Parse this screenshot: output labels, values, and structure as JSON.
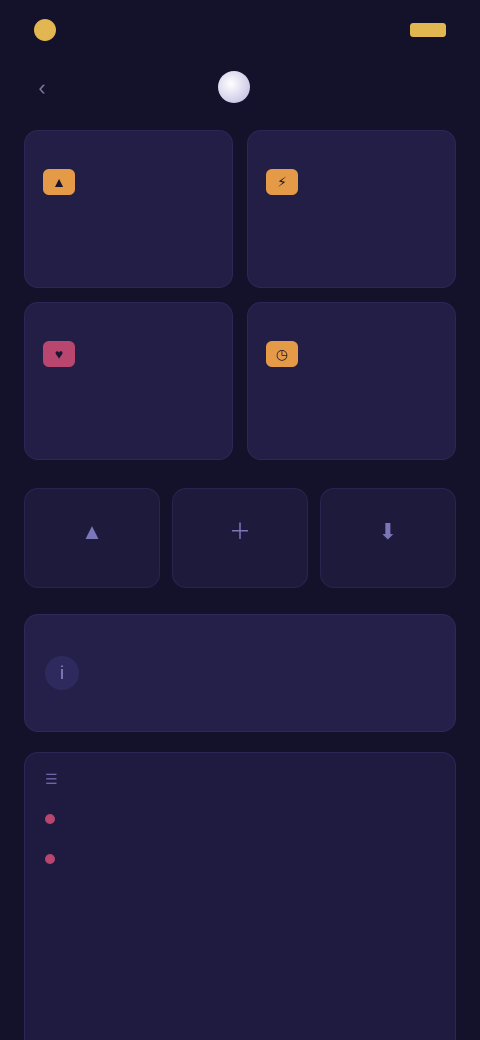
{
  "status_bar": {
    "left_text": "",
    "right_text": ""
  },
  "header": {
    "title": ""
  },
  "stats": [
    {
      "label": "",
      "value": "",
      "unit": "",
      "icon": "flame-icon",
      "color": "#e59a48"
    },
    {
      "label": "",
      "value": "",
      "unit": "",
      "icon": "bolt-icon",
      "color": "#e59a48"
    },
    {
      "label": "",
      "value": "",
      "unit": "",
      "icon": "heart-icon",
      "color": "#c7507a"
    },
    {
      "label": "",
      "value": "",
      "unit": "",
      "icon": "clock-icon",
      "color": "#e59a48"
    }
  ],
  "actions": [
    {
      "label": "",
      "icon": "triangle-up-icon"
    },
    {
      "label": "",
      "icon": "plus-icon"
    },
    {
      "label": "",
      "icon": "download-icon"
    }
  ],
  "notice": {
    "text": ""
  },
  "feed": {
    "title": "",
    "items": [
      {
        "tag": "",
        "text": ""
      },
      {
        "tag": "",
        "text": ""
      }
    ]
  },
  "colors": {
    "background": "#14122a",
    "card": "#221e46",
    "accent_orange": "#e59a48",
    "accent_pink": "#c7507a",
    "status_gold": "#e2b650"
  }
}
